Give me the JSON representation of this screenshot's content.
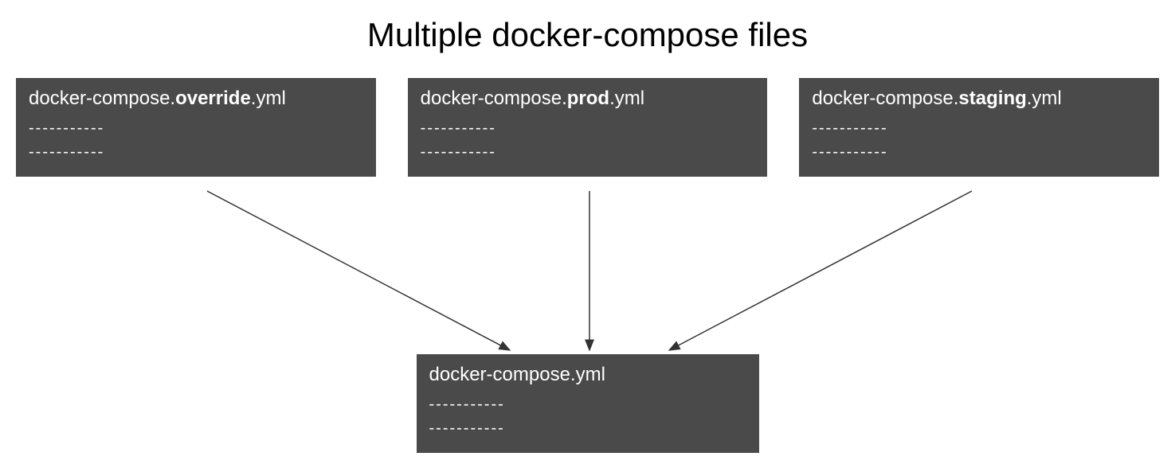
{
  "title": "Multiple docker-compose files",
  "boxes": {
    "override": {
      "prefix": "docker-compose.",
      "bold": "override",
      "suffix": ".yml",
      "line1": "-----------",
      "line2": "-----------"
    },
    "prod": {
      "prefix": "docker-compose.",
      "bold": "prod",
      "suffix": ".yml",
      "line1": "-----------",
      "line2": "-----------"
    },
    "staging": {
      "prefix": "docker-compose.",
      "bold": "staging",
      "suffix": ".yml",
      "line1": "-----------",
      "line2": "-----------"
    },
    "base": {
      "name": "docker-compose.yml",
      "line1": "-----------",
      "line2": "-----------"
    }
  }
}
